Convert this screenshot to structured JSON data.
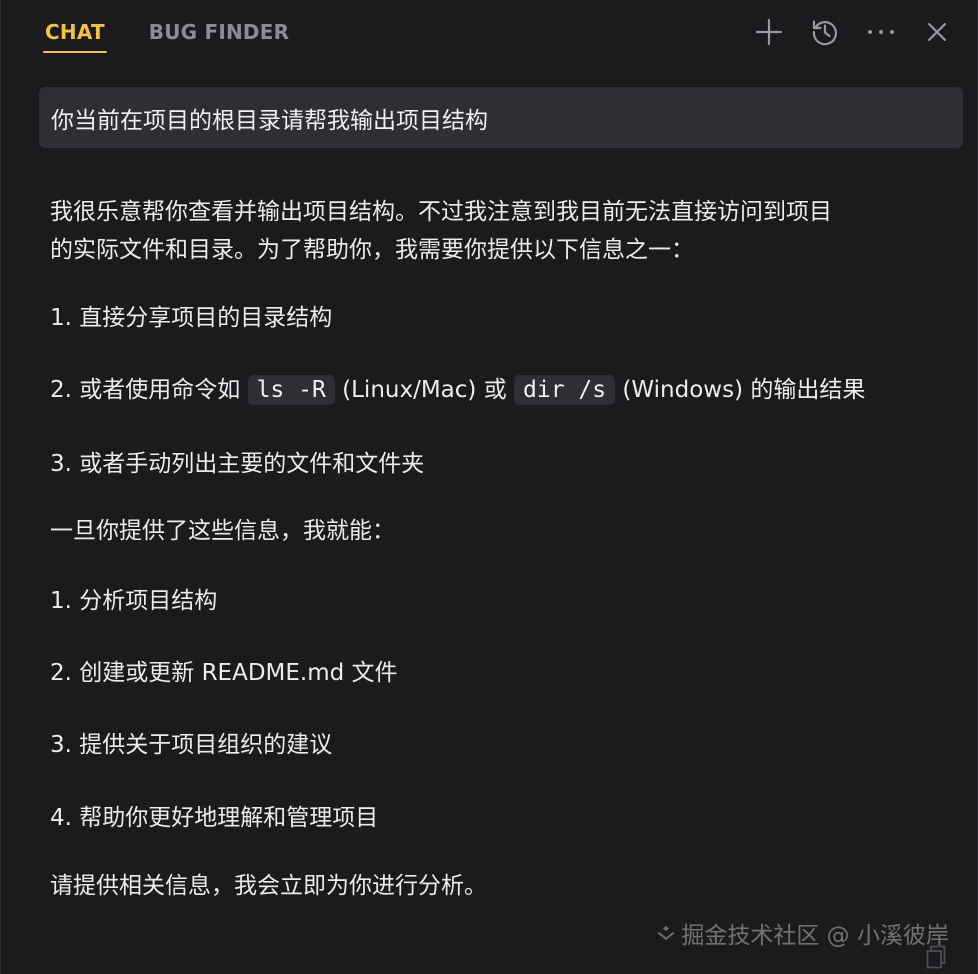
{
  "header": {
    "tabs": [
      {
        "label": "CHAT",
        "active": true
      },
      {
        "label": "BUG FINDER",
        "active": false
      }
    ],
    "accent_color": "#f2c04b",
    "action_icons": [
      "plus-icon",
      "history-icon",
      "more-icon",
      "close-icon"
    ]
  },
  "prompt": {
    "text": "你当前在项目的根目录请帮我输出项目结构"
  },
  "response": {
    "intro_line1": "我很乐意帮你查看并输出项目结构。不过我注意到我目前无法直接访问到项目",
    "intro_line2": "的实际文件和目录。为了帮助你，我需要你提供以下信息之一：",
    "options": {
      "item1": "1. 直接分享项目的目录结构",
      "item2_prefix": "2. 或者使用命令如 ",
      "item2_code1": "ls -R",
      "item2_mid": " (Linux/Mac) 或 ",
      "item2_code2": "dir /s",
      "item2_suffix": " (Windows) 的输出结果",
      "item3": "3. 或者手动列出主要的文件和文件夹"
    },
    "followup": "一旦你提供了这些信息，我就能：",
    "capabilities": [
      "1. 分析项目结构",
      "2. 创建或更新 README.md 文件",
      "3. 提供关于项目组织的建议",
      "4. 帮助你更好地理解和管理项目"
    ],
    "closing": "请提供相关信息，我会立即为你进行分析。"
  },
  "watermark": {
    "text": "掘金技术社区 @ 小溪彼岸"
  }
}
